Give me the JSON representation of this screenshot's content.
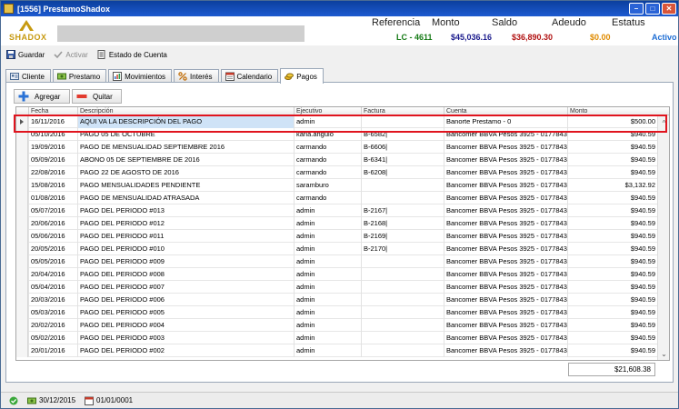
{
  "window": {
    "title": "[1556] PrestamoShadox",
    "min_label": "–",
    "max_label": "□",
    "close_label": "✕"
  },
  "header": {
    "logo_text": "SHADOX",
    "stats": [
      {
        "label": "Referencia",
        "value": "LC - 4611",
        "color": "#157a15"
      },
      {
        "label": "Monto",
        "value": "$45,036.16",
        "color": "#1a1a8c"
      },
      {
        "label": "Saldo",
        "value": "$36,890.30",
        "color": "#b11212"
      },
      {
        "label": "Adeudo",
        "value": "$0.00",
        "color": "#e08b00"
      },
      {
        "label": "Estatus",
        "value": "Activo",
        "color": "#1f6ed4"
      }
    ]
  },
  "toolbar": {
    "guardar": "Guardar",
    "activar": "Activar",
    "estado": "Estado de Cuenta"
  },
  "tabs": [
    {
      "label": "Cliente",
      "icon": "user-card-icon"
    },
    {
      "label": "Prestamo",
      "icon": "money-icon"
    },
    {
      "label": "Movimientos",
      "icon": "chart-icon"
    },
    {
      "label": "Interés",
      "icon": "percent-icon"
    },
    {
      "label": "Calendario",
      "icon": "calendar-icon"
    },
    {
      "label": "Pagos",
      "icon": "coins-icon"
    }
  ],
  "actions": {
    "agregar": "Agregar",
    "quitar": "Quitar"
  },
  "grid": {
    "columns": [
      "Fecha",
      "Descripción",
      "Ejecutivo",
      "Factura",
      "Cuenta",
      "Monto"
    ],
    "rows": [
      [
        "16/11/2016",
        "AQUI VA LA DESCRIPCIÓN DEL PAGO",
        "admin",
        "",
        "Banorte Prestamo - 0",
        "$500.00"
      ],
      [
        "05/10/2016",
        "PAGO 05 DE OCTUBRE",
        "karla.angulo",
        "B-6582|",
        "Bancomer BBVA Pesos 3925 - 0177843...",
        "$940.59"
      ],
      [
        "19/09/2016",
        "PAGO DE MENSUALIDAD SEPTIEMBRE 2016",
        "carmando",
        "B-6606|",
        "Bancomer BBVA Pesos 3925 - 0177843...",
        "$940.59"
      ],
      [
        "05/09/2016",
        "ABONO 05 DE SEPTIEMBRE DE 2016",
        "carmando",
        "B-6341|",
        "Bancomer BBVA Pesos 3925 - 0177843...",
        "$940.59"
      ],
      [
        "22/08/2016",
        "PAGO 22 DE AGOSTO DE 2016",
        "carmando",
        "B-6208|",
        "Bancomer BBVA Pesos 3925 - 0177843...",
        "$940.59"
      ],
      [
        "15/08/2016",
        "PAGO MENSUALIDADES PENDIENTE",
        "saramburo",
        "",
        "Bancomer BBVA Pesos 3925 - 0177843...",
        "$3,132.92"
      ],
      [
        "01/08/2016",
        "PAGO DE MENSUALIDAD ATRASADA",
        "carmando",
        "",
        "Bancomer BBVA Pesos 3925 - 0177843...",
        "$940.59"
      ],
      [
        "05/07/2016",
        "PAGO DEL PERIODO #013",
        "admin",
        "B-2167|",
        "Bancomer BBVA Pesos 3925 - 0177843...",
        "$940.59"
      ],
      [
        "20/06/2016",
        "PAGO DEL PERIODO #012",
        "admin",
        "B-2168|",
        "Bancomer BBVA Pesos 3925 - 0177843...",
        "$940.59"
      ],
      [
        "05/06/2016",
        "PAGO DEL PERIODO #011",
        "admin",
        "B-2169|",
        "Bancomer BBVA Pesos 3925 - 0177843...",
        "$940.59"
      ],
      [
        "20/05/2016",
        "PAGO DEL PERIODO #010",
        "admin",
        "B-2170|",
        "Bancomer BBVA Pesos 3925 - 0177843...",
        "$940.59"
      ],
      [
        "05/05/2016",
        "PAGO DEL PERIODO #009",
        "admin",
        "",
        "Bancomer BBVA Pesos 3925 - 0177843...",
        "$940.59"
      ],
      [
        "20/04/2016",
        "PAGO DEL PERIODO #008",
        "admin",
        "",
        "Bancomer BBVA Pesos 3925 - 0177843...",
        "$940.59"
      ],
      [
        "05/04/2016",
        "PAGO DEL PERIODO #007",
        "admin",
        "",
        "Bancomer BBVA Pesos 3925 - 0177843...",
        "$940.59"
      ],
      [
        "20/03/2016",
        "PAGO DEL PERIODO #006",
        "admin",
        "",
        "Bancomer BBVA Pesos 3925 - 0177843...",
        "$940.59"
      ],
      [
        "05/03/2016",
        "PAGO DEL PERIODO #005",
        "admin",
        "",
        "Bancomer BBVA Pesos 3925 - 0177843...",
        "$940.59"
      ],
      [
        "20/02/2016",
        "PAGO DEL PERIODO #004",
        "admin",
        "",
        "Bancomer BBVA Pesos 3925 - 0177843...",
        "$940.59"
      ],
      [
        "05/02/2016",
        "PAGO DEL PERIODO #003",
        "admin",
        "",
        "Bancomer BBVA Pesos 3925 - 0177843...",
        "$940.59"
      ],
      [
        "20/01/2016",
        "PAGO DEL PERIODO #002",
        "admin",
        "",
        "Bancomer BBVA Pesos 3925 - 0177843...",
        "$940.59"
      ]
    ],
    "total": "$21,608.38"
  },
  "statusbar": {
    "date1": "30/12/2015",
    "date2": "01/01/0001"
  }
}
